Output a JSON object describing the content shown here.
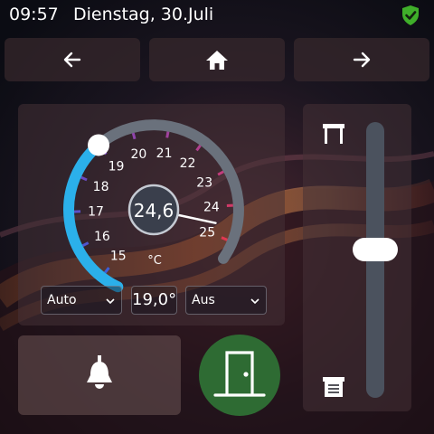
{
  "status_bar": {
    "time": "09:57",
    "date": "Dienstag, 30.Juli",
    "shield_icon": "shield-check-icon",
    "shield_color": "#3fae2a"
  },
  "nav": {
    "back_icon": "arrow-left-icon",
    "home_icon": "home-icon",
    "forward_icon": "arrow-right-icon"
  },
  "thermostat": {
    "current_temperature": "24,6",
    "unit": "°C",
    "scale_labels": [
      "15",
      "16",
      "17",
      "18",
      "19",
      "20",
      "21",
      "22",
      "23",
      "24",
      "25"
    ],
    "setpoint_value": 19.0,
    "setpoint_display": "19,0°",
    "mode_selected": "Auto",
    "secondary_selected": "Aus",
    "arc_color_active": "#2bb0ea",
    "arc_color_inactive": "#6a717c"
  },
  "shutter": {
    "open_icon": "shutter-open-icon",
    "closed_icon": "shutter-closed-icon",
    "position_fraction": 0.46
  },
  "buttons": {
    "bell_icon": "doorbell-icon",
    "door_icon": "door-icon",
    "door_button_color": "#2e6b33"
  }
}
